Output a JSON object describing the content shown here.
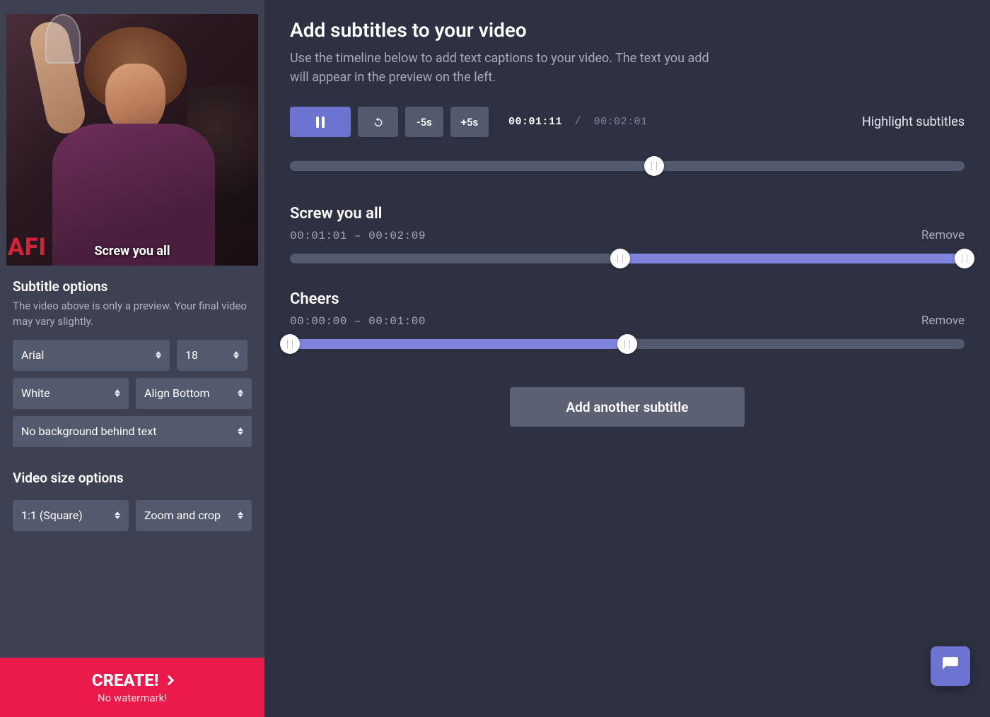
{
  "preview": {
    "caption": "Screw you all",
    "logo_text": "AFI"
  },
  "sidebar": {
    "subtitle_options": {
      "title": "Subtitle options",
      "description": "The video above is only a preview. Your final video may vary slightly.",
      "font": "Arial",
      "size": "18",
      "color": "White",
      "align": "Align Bottom",
      "background": "No background behind text"
    },
    "video_size": {
      "title": "Video size options",
      "aspect": "1:1 (Square)",
      "crop": "Zoom and crop"
    },
    "create": {
      "label": "CREATE!",
      "sub": "No watermark!"
    }
  },
  "main": {
    "title": "Add subtitles to your video",
    "lead": "Use the timeline below to add text captions to your video. The text you add will appear in the preview on the left.",
    "controls": {
      "minus5": "-5s",
      "plus5": "+5s",
      "current_time": "00:01:11",
      "separator": "/",
      "duration": "00:02:01",
      "highlight": "Highlight subtitles"
    },
    "playhead_percent": 54,
    "subtitles": [
      {
        "text": "Screw you all",
        "range": "00:01:01 – 00:02:09",
        "remove": "Remove",
        "start_percent": 49,
        "end_percent": 100
      },
      {
        "text": "Cheers",
        "range": "00:00:00 – 00:01:00",
        "remove": "Remove",
        "start_percent": 0,
        "end_percent": 50
      }
    ],
    "add_button": "Add another subtitle"
  }
}
